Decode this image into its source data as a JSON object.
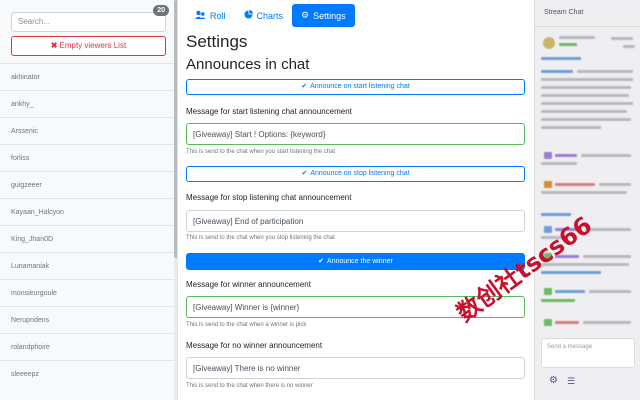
{
  "sidebar": {
    "search_placeholder": "Search...",
    "viewer_count": "20",
    "empty_button_label": "Empty viewers List",
    "viewers": [
      "akhinator",
      "ankhy_",
      "Arssenic",
      "forliss",
      "guigzeeer",
      "Kayaan_Halcyon",
      "King_Jhan0D",
      "Lunamaniak",
      "monsieurgoule",
      "Nerupridens",
      "rolandphoire",
      "sleeeepz"
    ]
  },
  "nav": {
    "tabs": [
      {
        "label": "Roll",
        "icon": "users-icon",
        "active": false
      },
      {
        "label": "Charts",
        "icon": "pie-chart-icon",
        "active": false
      },
      {
        "label": "Settings",
        "icon": "gear-icon",
        "active": true
      }
    ]
  },
  "settings": {
    "page_title": "Settings",
    "section_title": "Announces in chat",
    "start_button": "Announce on start listening chat",
    "start_label": "Message for start listening chat announcement",
    "start_value": "[Giveaway] Start ! Options: {keyword}",
    "start_help": "This is send to the chat when you start listening the chat",
    "stop_button": "Announce on stop listening chat",
    "stop_label": "Message for stop listening chat announcement",
    "stop_value": "[Giveaway] End of participation",
    "stop_help": "This is send to the chat when you stop listening the chat",
    "winner_button": "Announce the winner",
    "winner_label": "Message for winner announcement",
    "winner_value": "[Giveaway] Winner is {winner}",
    "winner_help": "This is send to the chat when a winner is pick",
    "nowinner_label": "Message for no winner announcement",
    "nowinner_value": "[Giveaway] There is no winner",
    "nowinner_help": "This is send to the chat when there is no winner"
  },
  "chat": {
    "title": "Stream Chat",
    "input_placeholder": "Send a message"
  },
  "colors": {
    "accent": "#007bff",
    "danger": "#dc3545",
    "valid": "#5cb85c",
    "twitch_purple": "#6441a5"
  },
  "watermark": "数创社tscs66"
}
